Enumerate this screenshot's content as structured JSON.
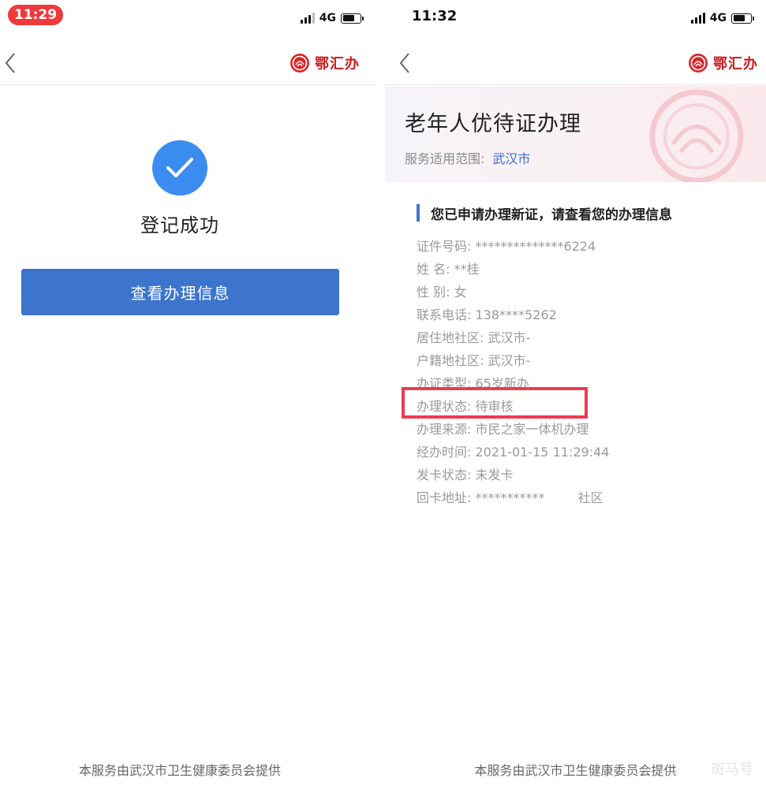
{
  "left": {
    "status": {
      "time": "11:29",
      "network": "4G"
    },
    "brand": "鄂汇办",
    "success_title": "登记成功",
    "button_label": "查看办理信息",
    "footer": "本服务由武汉市卫生健康委员会提供"
  },
  "right": {
    "status": {
      "time": "11:32",
      "network": "4G"
    },
    "brand": "鄂汇办",
    "title": "老年人优待证办理",
    "scope_label": "服务适用范围:",
    "scope_value": "武汉市",
    "section_title": "您已申请办理新证，请查看您的办理信息",
    "rows": [
      {
        "k": "证件号码",
        "v": "**************6224"
      },
      {
        "k": "姓 名",
        "v": "**桂"
      },
      {
        "k": "性 别",
        "v": "女"
      },
      {
        "k": "联系电话",
        "v": "138****5262"
      },
      {
        "k": "居住地社区",
        "v": "武汉市-"
      },
      {
        "k": "户籍地社区",
        "v": "武汉市-"
      },
      {
        "k": "办证类型",
        "v": "65岁新办"
      },
      {
        "k": "办理状态",
        "v": "待审核"
      },
      {
        "k": "办理来源",
        "v": "市民之家一体机办理"
      },
      {
        "k": "经办时间",
        "v": "2021-01-15 11:29:44"
      },
      {
        "k": "发卡状态",
        "v": "未发卡"
      },
      {
        "k": "回卡地址",
        "v": "***********"
      }
    ],
    "address_tail": "社区",
    "footer": "本服务由武汉市卫生健康委员会提供",
    "watermark": "斑马号"
  },
  "colors": {
    "primary": "#3d75cc",
    "success": "#3b8cf0",
    "highlight": "#ee3a4f",
    "brand": "#c81e1e",
    "time_pill": "#f0393a"
  },
  "icons": [
    "back-chevron-icon",
    "brand-logo-icon",
    "checkmark-icon",
    "signal-icon",
    "battery-icon"
  ]
}
